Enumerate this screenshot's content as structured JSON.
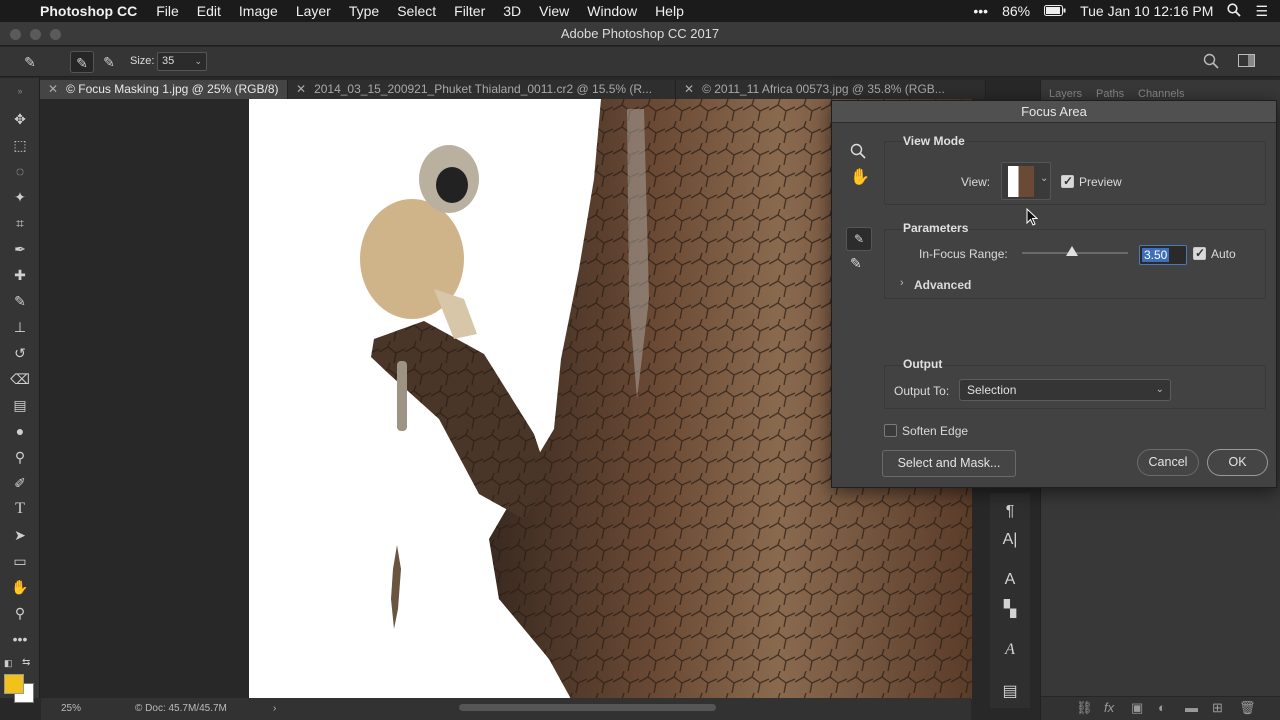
{
  "menubar": {
    "app": "Photoshop CC",
    "items": [
      "File",
      "Edit",
      "Image",
      "Layer",
      "Type",
      "Select",
      "Filter",
      "3D",
      "View",
      "Window",
      "Help"
    ],
    "battery": "86%",
    "datetime": "Tue Jan 10  12:16 PM"
  },
  "window": {
    "title": "Adobe Photoshop CC 2017"
  },
  "options": {
    "size_label": "Size:",
    "size_value": "35"
  },
  "tabs": [
    {
      "label": "© Focus Masking 1.jpg @ 25% (RGB/8)"
    },
    {
      "label": "2014_03_15_200921_Phuket Thialand_0011.cr2 @ 15.5% (R..."
    },
    {
      "label": "© 2011_11 Africa 00573.jpg @ 35.8% (RGB..."
    }
  ],
  "status": {
    "zoom": "25%",
    "doc": "Doc: 45.7M/45.7M"
  },
  "layers_panel": {
    "tabs": [
      "Layers",
      "Paths",
      "Channels"
    ]
  },
  "dialog": {
    "title": "Focus Area",
    "view_mode": {
      "heading": "View Mode",
      "view_label": "View:",
      "preview_label": "Preview",
      "preview_checked": true
    },
    "parameters": {
      "heading": "Parameters",
      "range_label": "In-Focus Range:",
      "range_value": "3.50",
      "range_fraction": 0.47,
      "auto_label": "Auto",
      "auto_checked": true,
      "advanced_label": "Advanced"
    },
    "output": {
      "heading": "Output",
      "output_to_label": "Output To:",
      "output_to_value": "Selection"
    },
    "soften_edge_label": "Soften Edge",
    "soften_edge_checked": false,
    "buttons": {
      "select_mask": "Select and Mask...",
      "cancel": "Cancel",
      "ok": "OK"
    }
  }
}
